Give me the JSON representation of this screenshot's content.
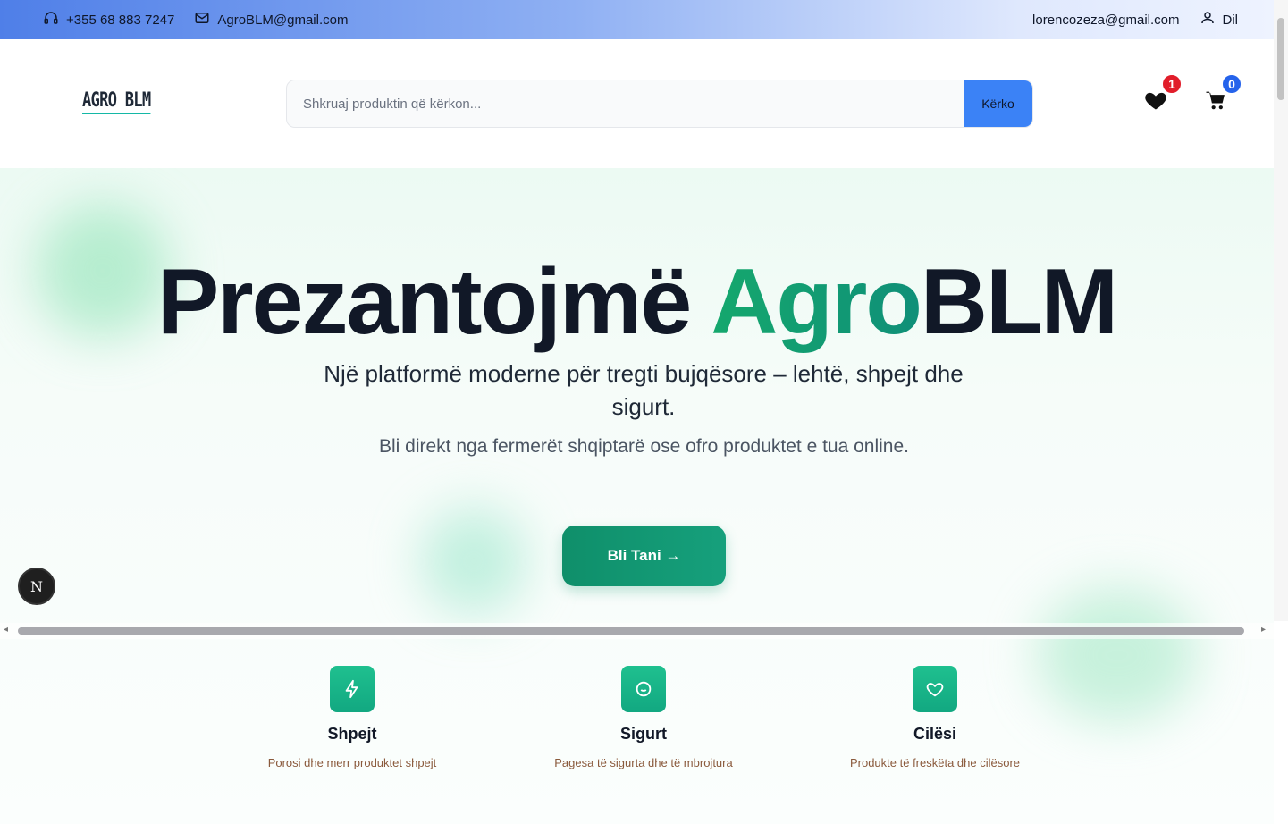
{
  "topbar": {
    "phone": "+355 68 883 7247",
    "email": "AgroBLM@gmail.com",
    "user_email": "lorencozeza@gmail.com",
    "logout_label": "Dil"
  },
  "header": {
    "logo": "AGRO BLM",
    "search_placeholder": "Shkruaj produktin që kërkon...",
    "search_button": "Kërko",
    "wishlist_count": "1",
    "cart_count": "0"
  },
  "hero": {
    "title_part1": "Prezantojmë",
    "title_green": "Agro",
    "title_part2": "BLM",
    "subtitle": "Një platformë moderne për tregti bujqësore – lehtë, shpejt dhe sigurt.",
    "tagline": "Bli direkt nga fermerët shqiptarë ose ofro produktet e tua online.",
    "cta": "Bli Tani →"
  },
  "features": [
    {
      "title": "Shpejt",
      "desc": "Porosi dhe merr produktet shpejt",
      "icon": "lightning-icon"
    },
    {
      "title": "Sigurt",
      "desc": "Pagesa të sigurta dhe të mbrojtura",
      "icon": "shield-smile-icon"
    },
    {
      "title": "Cilësi",
      "desc": "Produkte të freskëta dhe cilësore",
      "icon": "heart-icon"
    }
  ],
  "fab_label": "N",
  "colors": {
    "accent_green": "#15a86d",
    "search_blue": "#3b82f6",
    "badge_red": "#e11d2a",
    "badge_blue": "#2563eb"
  }
}
